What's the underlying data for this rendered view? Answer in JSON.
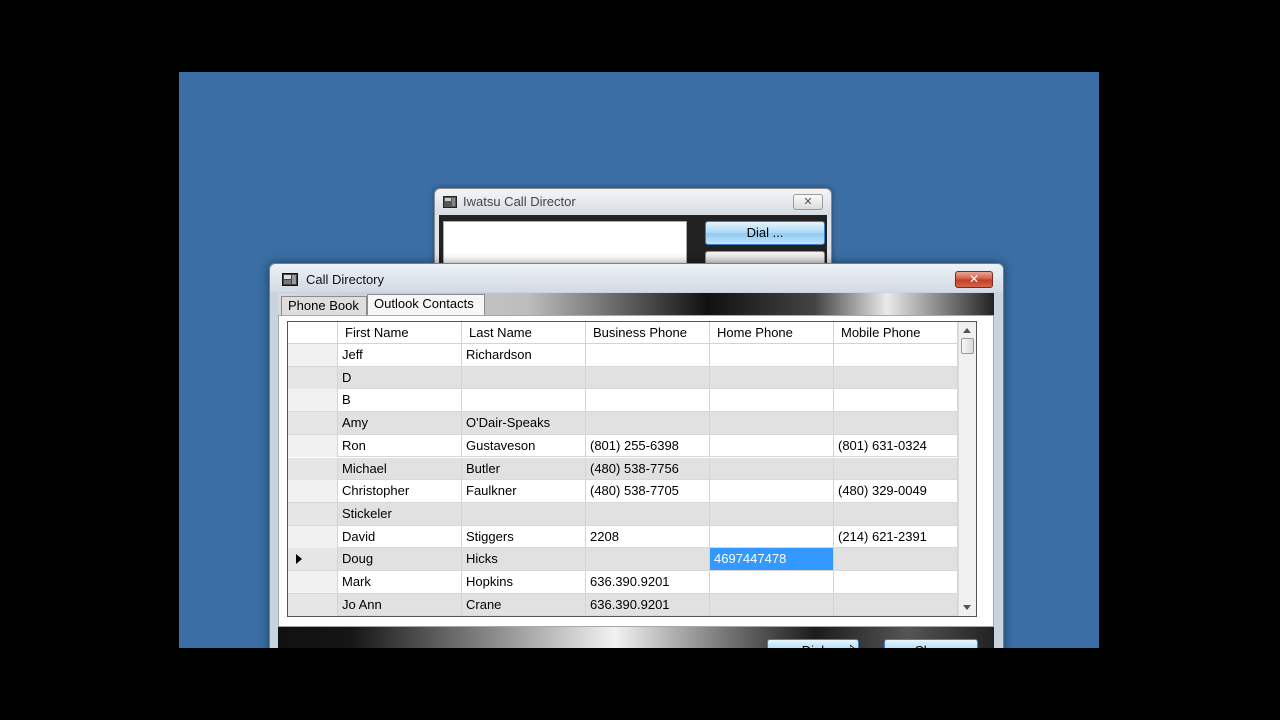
{
  "back_window": {
    "title": "Iwatsu Call Director",
    "close_glyph": "✕",
    "dial_label": "Dial ..."
  },
  "window": {
    "title": "Call Directory",
    "close_glyph": "✕"
  },
  "tabs": [
    {
      "label": "Phone Book"
    },
    {
      "label": "Outlook Contacts",
      "selected": true
    }
  ],
  "grid": {
    "columns": [
      "First Name",
      "Last Name",
      "Business Phone",
      "Home Phone",
      "Mobile Phone"
    ],
    "rows": [
      {
        "first": "Jeff",
        "last": "Richardson",
        "business": "",
        "home": "",
        "mobile": ""
      },
      {
        "first": "D",
        "last": "",
        "business": "",
        "home": "",
        "mobile": ""
      },
      {
        "first": "B",
        "last": "",
        "business": "",
        "home": "",
        "mobile": ""
      },
      {
        "first": "Amy",
        "last": "O'Dair-Speaks",
        "business": "",
        "home": "",
        "mobile": ""
      },
      {
        "first": "Ron",
        "last": "Gustaveson",
        "business": "(801) 255-6398",
        "home": "",
        "mobile": "(801) 631-0324"
      },
      {
        "first": "Michael",
        "last": "Butler",
        "business": "(480) 538-7756",
        "home": "",
        "mobile": ""
      },
      {
        "first": "Christopher",
        "last": "Faulkner",
        "business": "(480) 538-7705",
        "home": "",
        "mobile": "(480) 329-0049"
      },
      {
        "first": "Stickeler",
        "last": "",
        "business": "",
        "home": "",
        "mobile": ""
      },
      {
        "first": "David",
        "last": "Stiggers",
        "business": "2208",
        "home": "",
        "mobile": "(214) 621-2391"
      },
      {
        "first": "Doug",
        "last": "Hicks",
        "business": "",
        "home": "4697447478",
        "mobile": "",
        "current": true
      },
      {
        "first": "Mark",
        "last": "Hopkins",
        "business": "636.390.9201",
        "home": "",
        "mobile": ""
      },
      {
        "first": "Jo Ann",
        "last": "Crane",
        "business": "636.390.9201",
        "home": "",
        "mobile": ""
      }
    ]
  },
  "buttons": {
    "dial": "Dial",
    "close": "Close"
  },
  "colors": {
    "desktop": "#3a6ea5",
    "selection": "#3399ff",
    "button_blue": "#a9d8f6",
    "close_red": "#c13b22"
  }
}
